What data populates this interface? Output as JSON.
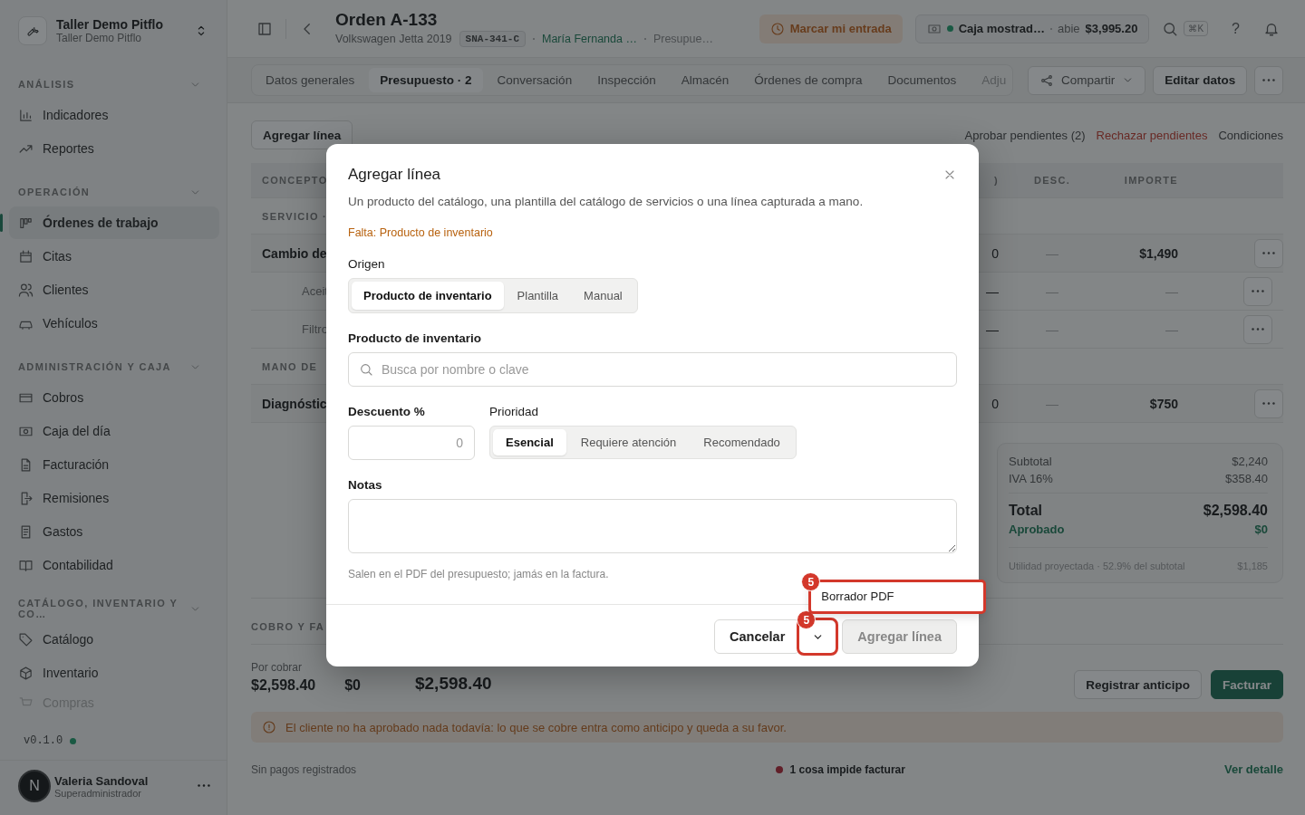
{
  "sidebar": {
    "workspace": {
      "name": "Taller Demo Pitflo",
      "subtitle": "Taller Demo Pitflo"
    },
    "sections": [
      {
        "title": "ANÁLISIS",
        "expanded": true,
        "items": [
          {
            "label": "Indicadores",
            "selected": false
          },
          {
            "label": "Reportes",
            "selected": false
          }
        ]
      },
      {
        "title": "OPERACIÓN",
        "expanded": true,
        "items": [
          {
            "label": "Órdenes de trabajo",
            "selected": true
          },
          {
            "label": "Citas",
            "selected": false
          },
          {
            "label": "Clientes",
            "selected": false
          },
          {
            "label": "Vehículos",
            "selected": false
          }
        ]
      },
      {
        "title": "ADMINISTRACIÓN Y CAJA",
        "expanded": true,
        "items": [
          {
            "label": "Cobros",
            "selected": false
          },
          {
            "label": "Caja del día",
            "selected": false
          },
          {
            "label": "Facturación",
            "selected": false
          },
          {
            "label": "Remisiones",
            "selected": false
          },
          {
            "label": "Gastos",
            "selected": false
          },
          {
            "label": "Contabilidad",
            "selected": false
          }
        ]
      },
      {
        "title": "CATÁLOGO, INVENTARIO Y CO…",
        "expanded": true,
        "items": [
          {
            "label": "Catálogo",
            "selected": false
          },
          {
            "label": "Inventario",
            "selected": false
          },
          {
            "label": "Compras",
            "selected": false
          }
        ]
      }
    ],
    "version": "v0.1.0",
    "user": {
      "initial": "N",
      "name": "Valeria Sandoval",
      "role": "Superadministrador"
    }
  },
  "header": {
    "title": "Orden A-133",
    "vehicle": "Volkswagen Jetta 2019",
    "plate": "SNA-341-C",
    "customer": "María Fernanda …",
    "status": "Presupue…",
    "clock_in": "Marcar mi entrada",
    "register": {
      "name": "Caja mostrad…",
      "state": "abie",
      "amount": "$3,995.20"
    },
    "shortcut": "⌘K",
    "help": "?"
  },
  "tabs": [
    {
      "label": "Datos generales",
      "selected": false
    },
    {
      "label": "Presupuesto · 2",
      "selected": true
    },
    {
      "label": "Conversación",
      "selected": false
    },
    {
      "label": "Inspección",
      "selected": false
    },
    {
      "label": "Almacén",
      "selected": false
    },
    {
      "label": "Órdenes de compra",
      "selected": false
    },
    {
      "label": "Documentos",
      "selected": false
    },
    {
      "label": "Adju",
      "selected": false
    }
  ],
  "actions": {
    "share": "Compartir",
    "edit": "Editar datos"
  },
  "budget": {
    "add_line": "Agregar línea",
    "approve": "Aprobar pendientes (2)",
    "reject": "Rechazar pendientes",
    "conditions": "Condiciones",
    "columns": {
      "concept": "CONCEPTO",
      "column_2": ")",
      "discount": "DESC.",
      "amount": "IMPORTE"
    },
    "rows": [
      {
        "kind": "section",
        "label": "SERVICIO ·"
      },
      {
        "kind": "line",
        "concept": "Cambio de",
        "column_2": "0",
        "discount": "—",
        "amount": "$1,490"
      },
      {
        "kind": "sub",
        "concept": "Aceit",
        "column_2": "—",
        "discount": "—",
        "amount": "—"
      },
      {
        "kind": "sub",
        "concept": "Filtro",
        "column_2": "—",
        "discount": "—",
        "amount": "—"
      },
      {
        "kind": "section",
        "label": "MANO DE"
      },
      {
        "kind": "line",
        "concept": "Diagnóstic",
        "column_2": "0",
        "discount": "—",
        "amount": "$750"
      }
    ],
    "summary": {
      "subtotal_label": "Subtotal",
      "subtotal": "$2,240",
      "tax_label": "IVA 16%",
      "tax": "$358.40",
      "total_label": "Total",
      "total": "$2,598.40",
      "approved_label": "Aprobado",
      "approved": "$0",
      "profit_label": "Utilidad proyectada · 52.9% del subtotal",
      "profit": "$1,185"
    }
  },
  "billing": {
    "title": "COBRO Y FA",
    "to_collect_label": "Por cobrar",
    "values": [
      "$2,598.40",
      "$0",
      "$2,598.40"
    ],
    "advance": "Registrar anticipo",
    "invoice": "Facturar",
    "warning": "El cliente no ha aprobado nada todavía: lo que se cobre entra como anticipo y queda a su favor.",
    "payments": "Sin pagos registrados",
    "blockers": "1 cosa impide facturar",
    "details": "Ver detalle"
  },
  "modal": {
    "title": "Agregar línea",
    "description": "Un producto del catálogo, una plantilla del catálogo de servicios o una línea capturada a mano.",
    "missing": "Falta: Producto de inventario",
    "origin_label": "Origen",
    "origins": [
      {
        "label": "Producto de inventario",
        "selected": true
      },
      {
        "label": "Plantilla",
        "selected": false
      },
      {
        "label": "Manual",
        "selected": false
      }
    ],
    "product_label": "Producto de inventario",
    "product_placeholder": "Busca por nombre o clave",
    "discount_label": "Descuento %",
    "discount_value": "0",
    "priority_label": "Prioridad",
    "priorities": [
      {
        "label": "Esencial",
        "selected": true
      },
      {
        "label": "Requiere atención",
        "selected": false
      },
      {
        "label": "Recomendado",
        "selected": false
      }
    ],
    "notes_label": "Notas",
    "notes_hint": "Salen en el PDF del presupuesto; jamás en la factura.",
    "menu": [
      {
        "label": "Borrador PDF",
        "annotation": "5"
      }
    ],
    "cancel": "Cancelar",
    "more": {
      "annotation": "5"
    },
    "submit": "Agregar línea",
    "submit_disabled": true
  }
}
